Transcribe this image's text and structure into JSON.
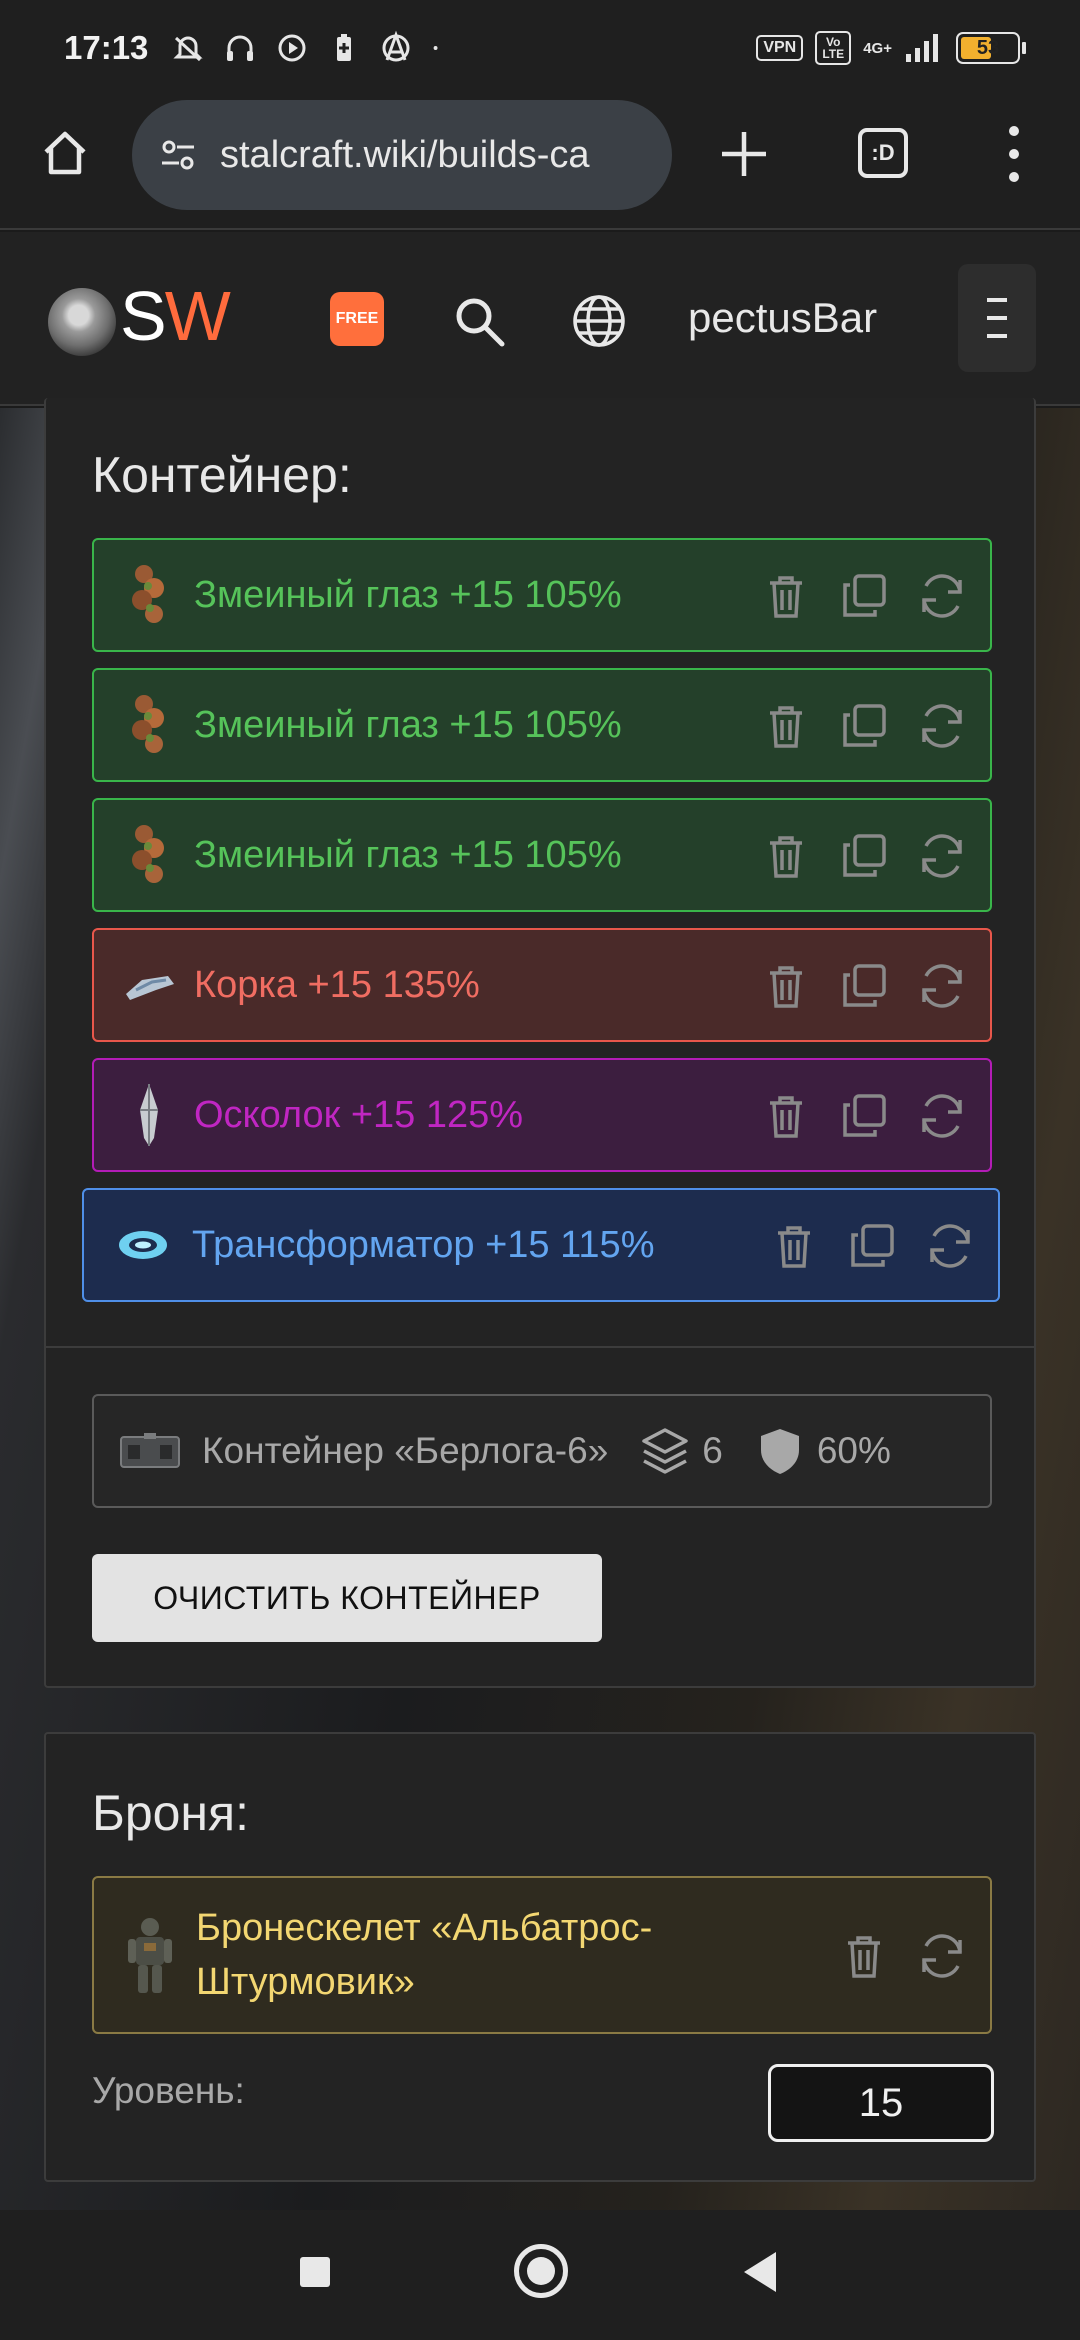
{
  "status_bar": {
    "time": "17:13",
    "vpn": "VPN",
    "volte": "Vo LTE",
    "network": "4G+",
    "battery": "53"
  },
  "browser": {
    "url": "stalcraft.wiki/builds-ca",
    "tabs_count": ":D"
  },
  "site_header": {
    "logo_s": "S",
    "logo_w": "W",
    "free_badge": "FREE",
    "username": "pectusBar"
  },
  "container_panel": {
    "title": "Контейнер:",
    "artifacts": [
      {
        "name": "Змеиный глаз +15 105%",
        "rarity": "green",
        "icon": "snake-eye-artifact-icon"
      },
      {
        "name": "Змеиный глаз +15 105%",
        "rarity": "green",
        "icon": "snake-eye-artifact-icon"
      },
      {
        "name": "Змеиный глаз +15 105%",
        "rarity": "green",
        "icon": "snake-eye-artifact-icon"
      },
      {
        "name": "Корка +15 135%",
        "rarity": "red",
        "icon": "crust-artifact-icon"
      },
      {
        "name": "Осколок +15 125%",
        "rarity": "purple",
        "icon": "shard-artifact-icon"
      },
      {
        "name": "Трансформатор +15 115%",
        "rarity": "blue",
        "icon": "transformer-artifact-icon"
      }
    ],
    "container": {
      "name": "Контейнер «Берлога-6»",
      "slots": "6",
      "protection": "60%"
    },
    "clear_button": "ОЧИСТИТЬ КОНТЕЙНЕР"
  },
  "armor_panel": {
    "title": "Броня:",
    "armor_name": "Бронескелет «Альбатрос-Штурмовик»",
    "level_label": "Уровень:",
    "level_value": "15"
  },
  "colors": {
    "green": "#56c35a",
    "red": "#f06d62",
    "purple": "#c026c2",
    "blue": "#63a5f0",
    "armor": "#f3d772",
    "logo_accent": "#ff6b3d"
  }
}
